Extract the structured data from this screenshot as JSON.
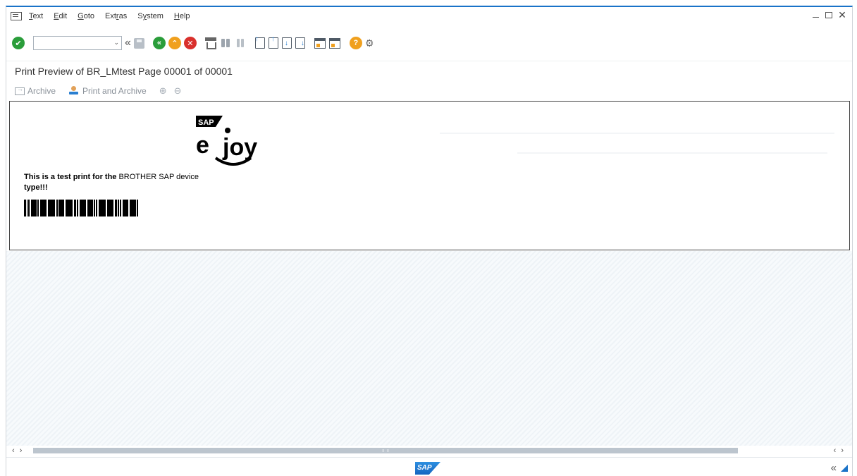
{
  "menu": {
    "items": [
      {
        "label": "Text",
        "u": "T"
      },
      {
        "label": "Edit",
        "u": "E"
      },
      {
        "label": "Goto",
        "u": "G"
      },
      {
        "label": "Extras",
        "u": "r"
      },
      {
        "label": "System",
        "u": "y"
      },
      {
        "label": "Help",
        "u": "H"
      }
    ]
  },
  "toolbar": {
    "command_field_value": "",
    "command_field_placeholder": ""
  },
  "title": "Print Preview of BR_LMtest Page 00001 of 00001",
  "app_toolbar": {
    "archive_label": "Archive",
    "print_archive_label": "Print and Archive"
  },
  "document": {
    "text_bold": "This is a test print for the",
    "text_regular": "BROTHER SAP device",
    "text_line2": "type!!!",
    "logo_text_sap": "SAP",
    "logo_text_e": "e",
    "logo_text_joy": "joy"
  },
  "status": {
    "sap_logo": "SAP"
  },
  "colors": {
    "accent": "#1a73c8",
    "ok_green": "#2a9d3a",
    "exit_orange": "#f0a01e",
    "cancel_red": "#d9302c"
  }
}
